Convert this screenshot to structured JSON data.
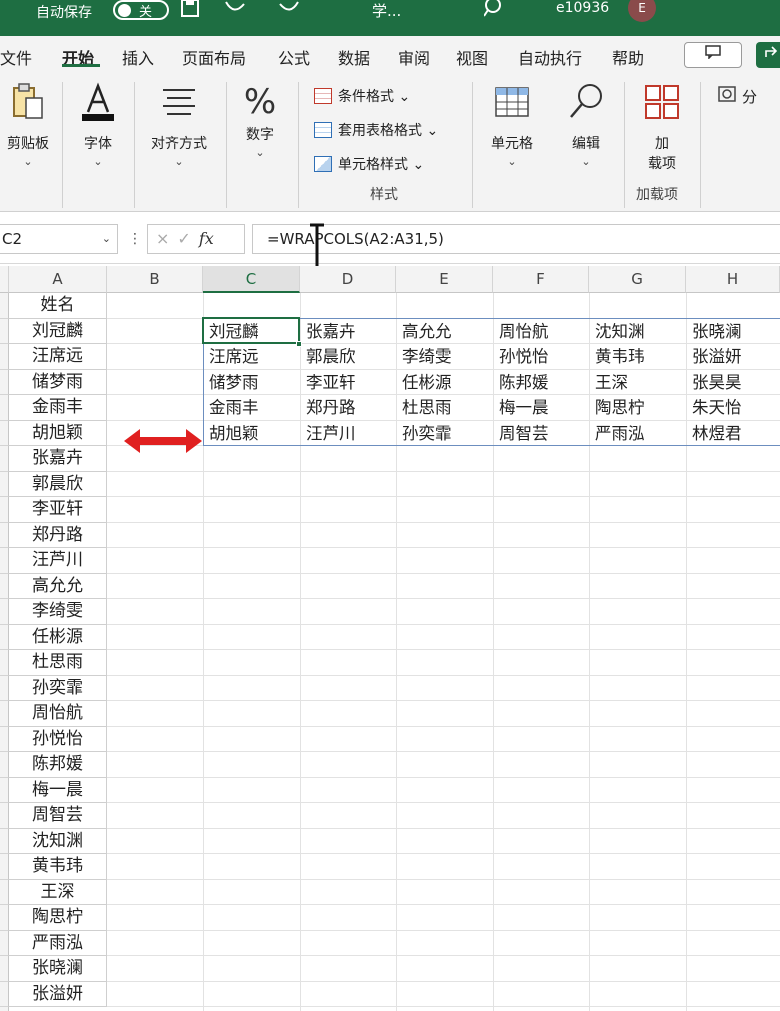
{
  "titlebar": {
    "autosave_label": "自动保存",
    "autosave_state": "关",
    "save_icon": "save-icon",
    "undo_icon": "undo-icon",
    "redo_icon": "redo-icon",
    "file_name": "学...",
    "search_icon": "search-icon",
    "user_id": "e10936",
    "avatar_initial": "E",
    "accent": "#1e6e42"
  },
  "tabs": [
    "文件",
    "开始",
    "插入",
    "页面布局",
    "公式",
    "数据",
    "审阅",
    "视图",
    "自动执行",
    "帮助"
  ],
  "active_tab": "开始",
  "comment_icon": "comment-icon",
  "share_icon": "share-icon",
  "ribbon": {
    "clipboard": {
      "label": "剪贴板",
      "icon": "clipboard-icon"
    },
    "font": {
      "label": "字体",
      "icon": "font-color-icon"
    },
    "alignment": {
      "label": "对齐方式",
      "icon": "align-icon"
    },
    "number": {
      "label": "数字",
      "icon": "percent-icon"
    },
    "styles": {
      "items": [
        "条件格式",
        "套用表格格式",
        "单元格样式"
      ],
      "group_label": "样式"
    },
    "cells": {
      "label": "单元格",
      "icon": "cells-icon"
    },
    "editing": {
      "label": "编辑",
      "icon": "search-edit-icon"
    },
    "addins": {
      "label_line1": "加",
      "label_line2": "载项",
      "group_label": "加载项",
      "icon": "addins-icon"
    },
    "analyze": {
      "label": "分",
      "icon": "analyze-icon"
    }
  },
  "formula_bar": {
    "name_box": "C2",
    "formula": "=WRAPCOLS(A2:A31,5)",
    "cancel_icon": "×",
    "enter_icon": "✓",
    "fx_label": "fx"
  },
  "columns": [
    "A",
    "B",
    "C",
    "D",
    "E",
    "F",
    "G",
    "H"
  ],
  "selected_column": "C",
  "column_a": [
    "姓名",
    "刘冠麟",
    "汪席远",
    "储梦雨",
    "金雨丰",
    "胡旭颖",
    "张嘉卉",
    "郭晨欣",
    "李亚轩",
    "郑丹路",
    "汪芦川",
    "高允允",
    "李绮雯",
    "任彬源",
    "杜思雨",
    "孙奕霏",
    "周怡航",
    "孙悦怡",
    "陈邦媛",
    "梅一晨",
    "周智芸",
    "沈知渊",
    "黄韦玮",
    "王深",
    "陶思柠",
    "严雨泓",
    "张晓澜",
    "张溢妍"
  ],
  "wrapcols_result": [
    [
      "刘冠麟",
      "张嘉卉",
      "高允允",
      "周怡航",
      "沈知渊",
      "张晓澜"
    ],
    [
      "汪席远",
      "郭晨欣",
      "李绮雯",
      "孙悦怡",
      "黄韦玮",
      "张溢妍"
    ],
    [
      "储梦雨",
      "李亚轩",
      "任彬源",
      "陈邦媛",
      "王深",
      "张昊昊"
    ],
    [
      "金雨丰",
      "郑丹路",
      "杜思雨",
      "梅一晨",
      "陶思柠",
      "朱天怡"
    ],
    [
      "胡旭颖",
      "汪芦川",
      "孙奕霏",
      "周智芸",
      "严雨泓",
      "林煜君"
    ]
  ],
  "annotation_arrow_color": "#e02020"
}
